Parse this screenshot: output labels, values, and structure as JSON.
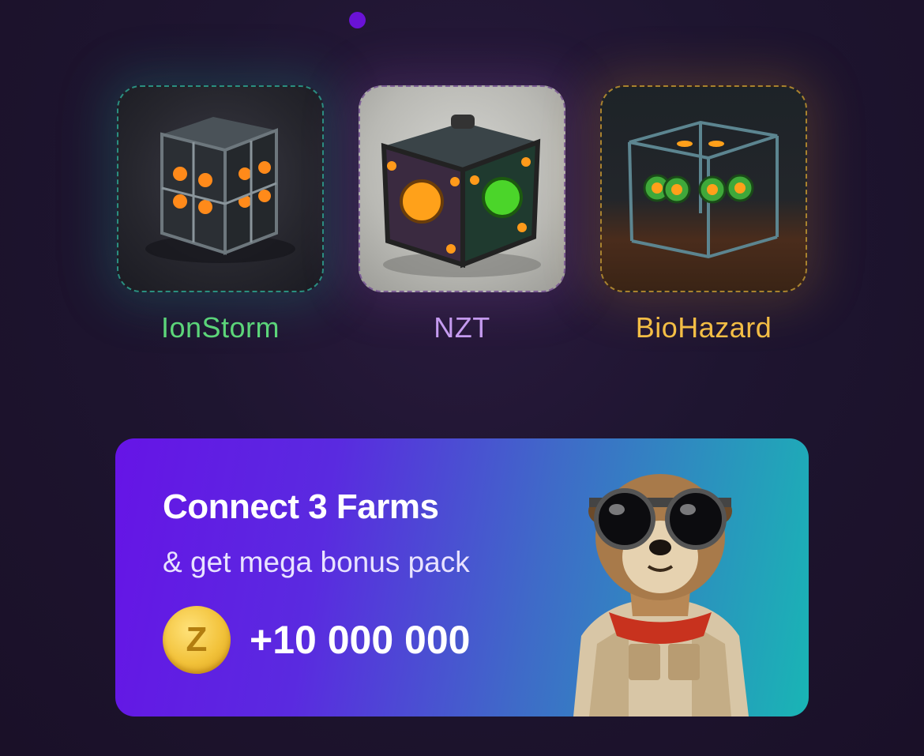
{
  "pagination": {
    "active_index": 0
  },
  "farms": [
    {
      "name": "IonStorm",
      "color": "#5fd87a",
      "border": "#2a8f80",
      "image_icon": "mining-rig-cube-icon"
    },
    {
      "name": "NZT",
      "color": "#c79ef2",
      "border": "#7d5f96",
      "image_icon": "mining-box-gems-icon"
    },
    {
      "name": "BioHazard",
      "color": "#f5c047",
      "border": "#a8822e",
      "image_icon": "mining-cage-icon"
    }
  ],
  "banner": {
    "title": "Connect 3 Farms",
    "subtitle": "& get mega bonus pack",
    "coin_icon": "z-coin-icon",
    "coin_glyph": "Z",
    "amount": "+10 000 000",
    "mascot_icon": "meerkat-mascot-icon"
  }
}
